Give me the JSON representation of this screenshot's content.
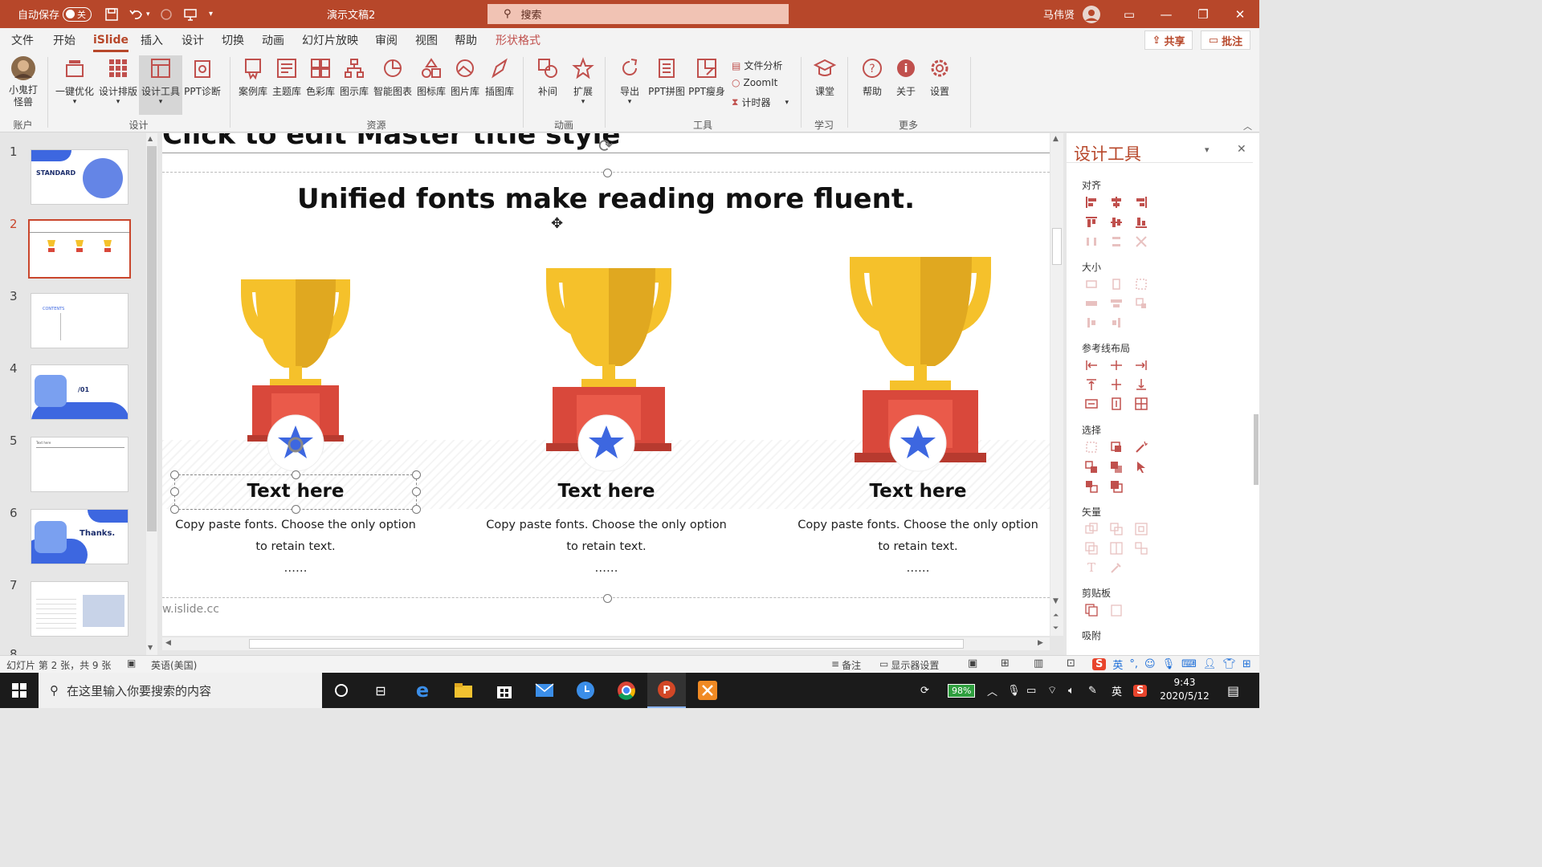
{
  "titlebar": {
    "autosave_label": "自动保存",
    "autosave_state": "关",
    "doc_title": "演示文稿2",
    "search_placeholder": "搜索",
    "user_name": "马伟贤"
  },
  "tabs": [
    "文件",
    "开始",
    "iSlide",
    "插入",
    "设计",
    "切换",
    "动画",
    "幻灯片放映",
    "审阅",
    "视图",
    "帮助",
    "形状格式"
  ],
  "active_tab": "iSlide",
  "share_label": "共享",
  "comment_label": "批注",
  "ribbon": {
    "account_label": "小鬼打怪兽",
    "account_group": "账户",
    "buttons": [
      "一键优化",
      "设计排版",
      "设计工具",
      "PPT诊断",
      "案例库",
      "主题库",
      "色彩库",
      "图示库",
      "智能图表",
      "图标库",
      "图片库",
      "插图库",
      "补间",
      "扩展",
      "导出",
      "PPT拼图",
      "PPT瘦身",
      "课堂",
      "帮助",
      "关于",
      "设置"
    ],
    "small_buttons": [
      "文件分析",
      "ZoomIt",
      "计时器"
    ],
    "groups": [
      "设计",
      "资源",
      "动画",
      "工具",
      "学习",
      "更多"
    ]
  },
  "slides": [
    {
      "num": "1",
      "title": "STANDARD"
    },
    {
      "num": "2",
      "title": "Unified fonts make reading more fluent."
    },
    {
      "num": "3",
      "title": "CONTENTS"
    },
    {
      "num": "4",
      "title": "/01"
    },
    {
      "num": "5",
      "title": "Text here"
    },
    {
      "num": "6",
      "title": "Thanks."
    },
    {
      "num": "7",
      "title": ""
    },
    {
      "num": "8",
      "title": ""
    }
  ],
  "slide": {
    "master_title": "Click to edit Master title style",
    "headline": "Unified fonts make reading more fluent.",
    "columns": [
      {
        "title": "Text here",
        "line1": "Copy paste fonts. Choose the only option",
        "line2": "to retain text.",
        "dots": "……"
      },
      {
        "title": "Text here",
        "line1": "Copy paste fonts. Choose the only option",
        "line2": "to retain text.",
        "dots": "……"
      },
      {
        "title": "Text here",
        "line1": "Copy paste fonts. Choose the only option",
        "line2": "to retain text.",
        "dots": "……"
      }
    ],
    "footer": "w.islide.cc"
  },
  "design_pane": {
    "title": "设计工具",
    "sections": [
      "对齐",
      "大小",
      "参考线布局",
      "选择",
      "矢量",
      "剪贴板",
      "吸附"
    ]
  },
  "statusbar": {
    "slide_info": "幻灯片 第 2 张，共 9 张",
    "language": "英语(美国)",
    "notes": "备注",
    "display": "显示器设置"
  },
  "taskbar": {
    "search_placeholder": "在这里输入你要搜索的内容",
    "battery": "98%",
    "ime": "英",
    "time": "9:43",
    "date": "2020/5/12"
  },
  "colors": {
    "accent": "#b7472a",
    "trophy_gold": "#f5c12b",
    "trophy_red": "#d9483b",
    "star_blue": "#3d67e0"
  }
}
